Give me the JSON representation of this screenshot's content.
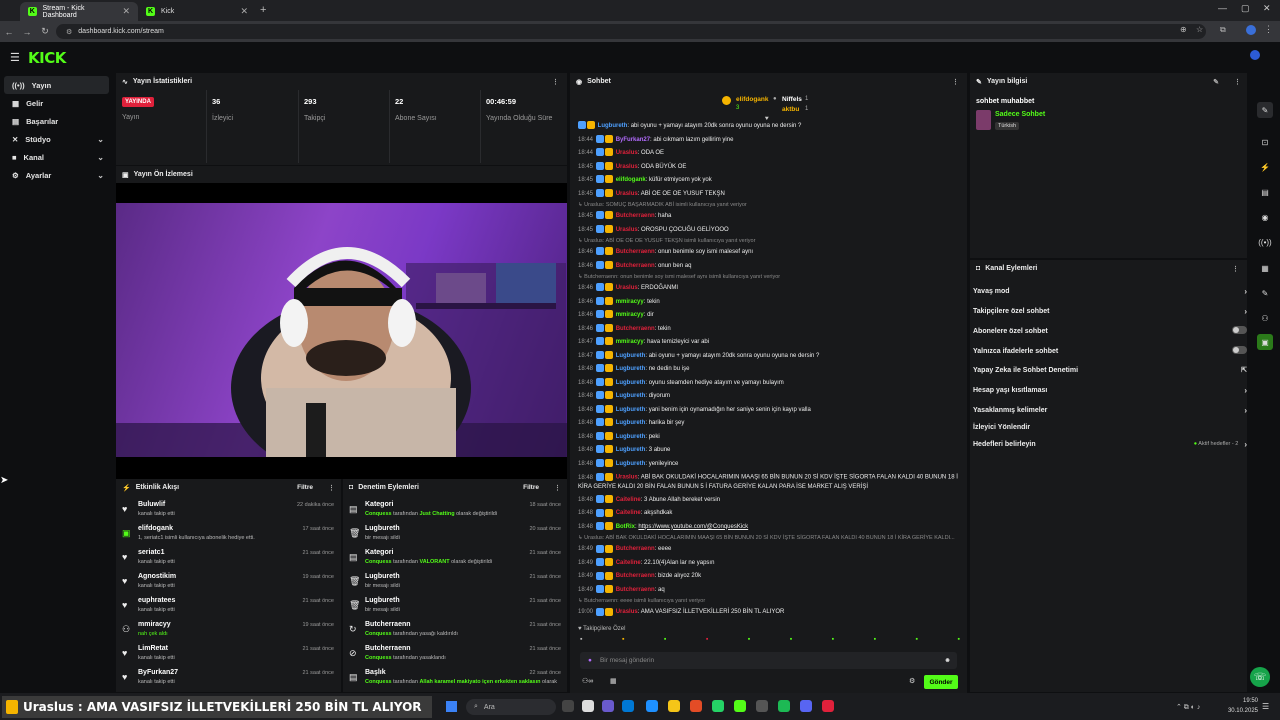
{
  "browser": {
    "tabs": [
      {
        "title": "Stream - Kick Dashboard"
      },
      {
        "title": "Kick"
      }
    ],
    "url": "dashboard.kick.com/stream"
  },
  "brand": {
    "logo": "KICK",
    "accent": "#53fc18"
  },
  "sidebar": {
    "items": [
      {
        "label": "Yayın",
        "icon": "broadcast-icon"
      },
      {
        "label": "Gelir",
        "icon": "income-icon"
      },
      {
        "label": "Başarılar",
        "icon": "achievements-icon"
      },
      {
        "label": "Stüdyo",
        "icon": "studio-icon"
      },
      {
        "label": "Kanal",
        "icon": "channel-icon"
      },
      {
        "label": "Ayarlar",
        "icon": "settings-icon"
      }
    ]
  },
  "stats": {
    "title": "Yayın İstatistikleri",
    "live_badge": "YAYINDA",
    "live_label": "Yayın",
    "viewers": {
      "value": "36",
      "label": "İzleyici"
    },
    "followers": {
      "value": "293",
      "label": "Takipçi"
    },
    "subs": {
      "value": "22",
      "label": "Abone Sayısı"
    },
    "uptime": {
      "value": "00:46:59",
      "label": "Yayında Olduğu Süre"
    }
  },
  "preview": {
    "title": "Yayın Ön İzlemesi"
  },
  "activity": {
    "title": "Etkinlik Akışı",
    "filter": "Filtre",
    "items": [
      {
        "name": "Buluwlif",
        "desc": "kanalı takip etti",
        "time": "22 dakika önce"
      },
      {
        "name": "elifdogank",
        "desc": "1, seriatc1 isimli kullanıcıya abonelik hediye etti.",
        "time": "17 saat önce"
      },
      {
        "name": "seriatc1",
        "desc": "kanalı takip etti",
        "time": "21 saat önce"
      },
      {
        "name": "Agnostikim",
        "desc": "kanalı takip etti",
        "time": "19 saat önce"
      },
      {
        "name": "euphratees",
        "desc": "kanalı takip etti",
        "time": "21 saat önce"
      },
      {
        "name": "mmiracyy",
        "desc": "nah çek aldı",
        "time": "19 saat önce"
      },
      {
        "name": "LimRetat",
        "desc": "kanalı takip etti",
        "time": "21 saat önce"
      },
      {
        "name": "ByFurkan27",
        "desc": "kanalı takip etti",
        "time": "21 saat önce"
      }
    ]
  },
  "moderation": {
    "title": "Denetim Eylemleri",
    "filter": "Filtre",
    "items": [
      {
        "name": "Kategori",
        "actor": "Conquess",
        "mid": "tarafından",
        "hl": "Just Chatting",
        "tail": "olarak değiştirildi",
        "time": "18 saat önce"
      },
      {
        "name": "Lugbureth",
        "actor": "",
        "mid": "",
        "hl": "",
        "tail": "bir mesajı sildi",
        "time": "20 saat önce"
      },
      {
        "name": "Kategori",
        "actor": "Conquess",
        "mid": "tarafından",
        "hl": "VALORANT",
        "tail": "olarak değiştirildi",
        "time": "21 saat önce"
      },
      {
        "name": "Lugbureth",
        "actor": "",
        "mid": "",
        "hl": "",
        "tail": "bir mesajı sildi",
        "time": "21 saat önce"
      },
      {
        "name": "Lugbureth",
        "actor": "",
        "mid": "",
        "hl": "",
        "tail": "bir mesajı sildi",
        "time": "21 saat önce"
      },
      {
        "name": "Butcherraenn",
        "actor": "Conquess",
        "mid": "tarafından yasağı kaldırıldı",
        "hl": "",
        "tail": "",
        "time": "21 saat önce"
      },
      {
        "name": "Butcherraenn",
        "actor": "Conquess",
        "mid": "tarafından yasaklandı",
        "hl": "",
        "tail": "",
        "time": "21 saat önce"
      },
      {
        "name": "Başlık",
        "actor": "Conquess",
        "mid": "tarafından",
        "hl": "Allah karamel makiyato içen erkekten saklasın",
        "tail": "olarak",
        "time": "22 saat önce"
      }
    ]
  },
  "chat": {
    "title": "Sohbet",
    "top_users": [
      {
        "name": "elifdogank",
        "count": "3"
      },
      {
        "name": "Niffels",
        "count": "1"
      },
      {
        "name": "aktbu",
        "count": "1"
      }
    ],
    "messages": [
      {
        "time": "",
        "user": "Lugbureth",
        "color": "#4ea0ff",
        "text": "abi oyunu + yamayı atayım 20dk sonra oyunu oyuna ne dersin ?",
        "kind": "msg"
      },
      {
        "time": "18:44",
        "user": "ByFurkan27",
        "color": "#b36bff",
        "text": "abi cıkmam lazım gellirim yine",
        "kind": "msg"
      },
      {
        "time": "18:44",
        "user": "Uraslus",
        "color": "#e0213b",
        "text": "ODA OE",
        "kind": "msg"
      },
      {
        "time": "18:45",
        "user": "Uraslus",
        "color": "#e0213b",
        "text": "ODA BÜYÜK OE",
        "kind": "msg"
      },
      {
        "time": "18:45",
        "user": "elifdogank",
        "color": "#53fc18",
        "text": "küfür etmiycem yok yok",
        "kind": "msg"
      },
      {
        "time": "18:45",
        "user": "Uraslus",
        "color": "#e0213b",
        "text": "ABİ OE OE OE YUSUF TEKŞN",
        "kind": "msg"
      },
      {
        "time": "",
        "user": "",
        "color": "#888",
        "text": "Uraslus: SOMUÇ BAŞARMADIK ABİ isimli kullanıcıya yanıt veriyor",
        "kind": "reply"
      },
      {
        "time": "18:45",
        "user": "Butcherraenn",
        "color": "#e0213b",
        "text": "haha",
        "kind": "msg"
      },
      {
        "time": "18:45",
        "user": "Uraslus",
        "color": "#e0213b",
        "text": "OROSPU ÇOCUĞU GELİYOOO",
        "kind": "msg"
      },
      {
        "time": "",
        "user": "",
        "color": "#888",
        "text": "Uraslus: ABİ OE OE OE YUSUF TEKŞN isimli kullanıcıya yanıt veriyor",
        "kind": "reply"
      },
      {
        "time": "18:46",
        "user": "Butcherraenn",
        "color": "#e0213b",
        "text": "onun benimle soy ismi malesef aynı",
        "kind": "msg"
      },
      {
        "time": "18:46",
        "user": "Butcherraenn",
        "color": "#e0213b",
        "text": "onun ben aq",
        "kind": "msg"
      },
      {
        "time": "",
        "user": "",
        "color": "#888",
        "text": "Butcherraenn: onun benimle soy ismi malesef aynı isimli kullanıcıya yanıt veriyor",
        "kind": "reply"
      },
      {
        "time": "18:46",
        "user": "Uraslus",
        "color": "#e0213b",
        "text": "ERDOĞANMI",
        "kind": "msg"
      },
      {
        "time": "18:46",
        "user": "mmiracyy",
        "color": "#53fc18",
        "text": "tekin",
        "kind": "msg"
      },
      {
        "time": "18:46",
        "user": "mmiracyy",
        "color": "#53fc18",
        "text": "dir",
        "kind": "msg"
      },
      {
        "time": "18:46",
        "user": "Butcherraenn",
        "color": "#e0213b",
        "text": "tekin",
        "kind": "msg"
      },
      {
        "time": "18:47",
        "user": "mmiracyy",
        "color": "#53fc18",
        "text": "hava temizleyici var abi",
        "kind": "msg"
      },
      {
        "time": "18:47",
        "user": "Lugbureth",
        "color": "#4ea0ff",
        "text": "abi oyunu + yamayı atayım 20dk sonra oyunu oyuna ne dersin ?",
        "kind": "msg"
      },
      {
        "time": "18:48",
        "user": "Lugbureth",
        "color": "#4ea0ff",
        "text": "ne dedin bu işe",
        "kind": "msg"
      },
      {
        "time": "18:48",
        "user": "Lugbureth",
        "color": "#4ea0ff",
        "text": "oyunu steamden hediye atayım ve yamayı bulayım",
        "kind": "msg"
      },
      {
        "time": "18:48",
        "user": "Lugbureth",
        "color": "#4ea0ff",
        "text": "diyorum",
        "kind": "msg"
      },
      {
        "time": "18:48",
        "user": "Lugbureth",
        "color": "#4ea0ff",
        "text": "yani benim için oynamadığın her saniye senin için kayıp valla",
        "kind": "msg"
      },
      {
        "time": "18:48",
        "user": "Lugbureth",
        "color": "#4ea0ff",
        "text": "harika bir şey",
        "kind": "msg"
      },
      {
        "time": "18:48",
        "user": "Lugbureth",
        "color": "#4ea0ff",
        "text": "peki",
        "kind": "msg"
      },
      {
        "time": "18:48",
        "user": "Lugbureth",
        "color": "#4ea0ff",
        "text": "3 abune",
        "kind": "msg"
      },
      {
        "time": "18:48",
        "user": "Lugbureth",
        "color": "#4ea0ff",
        "text": "yenileyince",
        "kind": "msg"
      },
      {
        "time": "18:48",
        "user": "Uraslus",
        "color": "#e0213b",
        "text": "ABİ BAK OKULDAKİ HOCALARIMIN MAAŞI 65 BİN BUNUN 20 Sİ KDV İŞTE SİGORTA FALAN KALDI 40 BUNUN 18 İ KİRA GERİYE KALDI 20 BİN FALAN BUNUN 5 İ FATURA GERİYE KALAN PARA İSE MARKET ALIŞ VERİŞİ",
        "kind": "wrap"
      },
      {
        "time": "18:48",
        "user": "Caiteline",
        "color": "#e0213b",
        "text": "3 Abune Allah bereket versin",
        "kind": "msg"
      },
      {
        "time": "18:48",
        "user": "Caiteline",
        "color": "#e0213b",
        "text": "akşshdkak",
        "kind": "msg"
      },
      {
        "time": "18:48",
        "user": "BotRix",
        "color": "#53fc18",
        "text": "https://www.youtube.com/@ConquesKick",
        "kind": "msg"
      },
      {
        "time": "",
        "user": "",
        "color": "#888",
        "text": "Uraslus: ABİ BAK OKULDAKİ HOCALARIMIN MAAŞI 65 BİN BUNUN 20 Sİ KDV İŞTE SİGORTA FALAN KALDI 40 BUNUN 18 İ KİRA GERİYE KALDI...",
        "kind": "reply"
      },
      {
        "time": "18:49",
        "user": "Butcherraenn",
        "color": "#e0213b",
        "text": "eeee",
        "kind": "msg"
      },
      {
        "time": "18:49",
        "user": "Caiteline",
        "color": "#e0213b",
        "text": "22.10(4)Alan lar ne yapsın",
        "kind": "msg"
      },
      {
        "time": "18:49",
        "user": "Butcherraenn",
        "color": "#e0213b",
        "text": "bizde alıyoz 20k",
        "kind": "msg"
      },
      {
        "time": "18:49",
        "user": "Butcherraenn",
        "color": "#e0213b",
        "text": "aq",
        "kind": "msg"
      },
      {
        "time": "",
        "user": "",
        "color": "#888",
        "text": "Butcherraenn: eeee isimli kullanıcıya yanıt veriyor",
        "kind": "reply"
      },
      {
        "time": "19:00",
        "user": "Uraslus",
        "color": "#e0213b",
        "text": "AMA VASIFSIZ İLLETVEKİLLERİ 250 BİN TL ALIYOR",
        "kind": "msg"
      }
    ],
    "followers_only": "Takipçilere Özel",
    "input_placeholder": "Bir mesaj gönderin",
    "send_label": "Gönder"
  },
  "stream_info": {
    "title": "Yayın bilgisi",
    "stream_title": "sohbet muhabbet",
    "category": "Sadece Sohbet",
    "language": "Türkish"
  },
  "channel_actions": {
    "title": "Kanal Eylemleri",
    "items": [
      {
        "label": "Yavaş mod",
        "control": "chevron"
      },
      {
        "label": "Takipçilere özel sohbet",
        "control": "chevron"
      },
      {
        "label": "Abonelere özel sohbet",
        "control": "toggle"
      },
      {
        "label": "Yalnızca ifadelerle sohbet",
        "control": "toggle"
      },
      {
        "label": "Yapay Zeka ile Sohbet Denetimi",
        "control": "external"
      },
      {
        "label": "Hesap yaşı kısıtlaması",
        "control": "chevron"
      },
      {
        "label": "Yasaklanmış kelimeler",
        "control": "chevron"
      },
      {
        "label": "İzleyici Yönlendir",
        "control": "none"
      },
      {
        "label": "Hedefleri belirleyin",
        "control": "chevron"
      }
    ],
    "active_goals": "Aktif hedefler - 2"
  },
  "taskbar": {
    "ticker": "Uraslus : AMA VASIFSIZ İLLETVEKİLLERİ 250 BİN TL ALIYOR",
    "search": "Ara",
    "time": "19:50",
    "date": "30.10.2025"
  }
}
